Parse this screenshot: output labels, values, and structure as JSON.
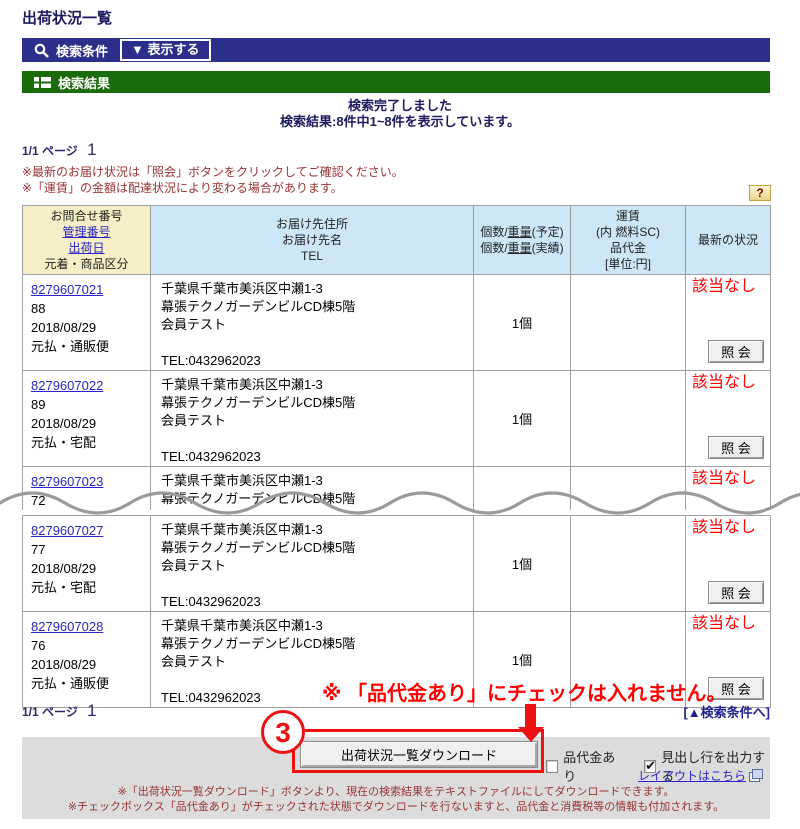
{
  "page_title": "出荷状況一覧",
  "colors": {
    "nav_bar_blue": "#2b2f8a",
    "result_bar_green": "#1a6b0a",
    "table_header_yellow": "#f5eec6",
    "table_header_blue": "#cde7f8",
    "link_blue": "#2a25c8",
    "alert_red": "#ff0000",
    "note_dark_red": "#993333",
    "panel_gray": "#dcdcdc"
  },
  "search_bar": {
    "condition_label": "検索条件",
    "show_button_label": "▼ 表示する"
  },
  "result_bar": {
    "label": "検索結果"
  },
  "status": {
    "line1": "検索完了しました",
    "line2": "検索結果:8件中1~8件を表示しています。"
  },
  "pagination": {
    "label": "1/1 ページ",
    "page_number": "1"
  },
  "notes_top": [
    "※最新のお届け状況は「照会」ボタンをクリックしてご確認ください。",
    "※「運賃」の金額は配達状況により変わる場合があります。"
  ],
  "help_button_label": "?",
  "table": {
    "header": {
      "inquiry_no_label": "お問合せ番号",
      "mgmt_no_link": "管理番号",
      "ship_date_link": "出荷日",
      "category_label": "元着・商品区分",
      "dest_lines": [
        "お届け先住所",
        "お届け先名",
        "TEL"
      ],
      "qty": {
        "l1a": "個数/",
        "l1b": "重量",
        "l1c": "(予定)",
        "l2a": "個数/",
        "l2b": "重量",
        "l2c": "(実績)"
      },
      "fare_lines": [
        "運賃",
        "(内 燃料SC)",
        "品代金",
        "[単位:円]"
      ],
      "status_label": "最新の状況"
    },
    "rows_top": [
      {
        "tracking_no": "8279607021",
        "mgmt_no": "88",
        "ship_date": "2018/08/29",
        "category": "元払・通販便",
        "address1": "千葉県千葉市美浜区中瀬1-3",
        "address2": "幕張テクノガーデンビルCD棟5階",
        "address3": "会員テスト",
        "tel": "TEL:0432962023",
        "qty": "1個",
        "fare": "",
        "status": "該当なし",
        "inquiry_button": "照 会"
      },
      {
        "tracking_no": "8279607022",
        "mgmt_no": "89",
        "ship_date": "2018/08/29",
        "category": "元払・宅配",
        "address1": "千葉県千葉市美浜区中瀬1-3",
        "address2": "幕張テクノガーデンビルCD棟5階",
        "address3": "会員テスト",
        "tel": "TEL:0432962023",
        "qty": "1個",
        "fare": "",
        "status": "該当なし",
        "inquiry_button": "照 会"
      },
      {
        "tracking_no": "8279607023",
        "mgmt_no": "72",
        "address1": "千葉県千葉市美浜区中瀬1-3",
        "address2": "幕張テクノガーデンビルCD棟5階",
        "status": "該当なし"
      }
    ],
    "rows_bottom": [
      {
        "tracking_no": "8279607027",
        "mgmt_no": "77",
        "ship_date": "2018/08/29",
        "category": "元払・宅配",
        "address1": "千葉県千葉市美浜区中瀬1-3",
        "address2": "幕張テクノガーデンビルCD棟5階",
        "address3": "会員テスト",
        "tel": "TEL:0432962023",
        "qty": "1個",
        "fare": "",
        "status": "該当なし",
        "inquiry_button": "照 会"
      },
      {
        "tracking_no": "8279607028",
        "mgmt_no": "76",
        "ship_date": "2018/08/29",
        "category": "元払・通販便",
        "address1": "千葉県千葉市美浜区中瀬1-3",
        "address2": "幕張テクノガーデンビルCD棟5階",
        "address3": "会員テスト",
        "tel": "TEL:0432962023",
        "qty": "1個",
        "fare": "",
        "status": "該当なし",
        "inquiry_button": "照 会"
      }
    ]
  },
  "annotation": {
    "text": "※ 「品代金あり」にチェックは入れません。",
    "step_number": "3"
  },
  "back_to_search_link": "[▲検索条件へ]",
  "download_section": {
    "download_button_label": "出荷状況一覧ダウンロード",
    "monetary_checkbox": {
      "label": "品代金あり",
      "checked": false
    },
    "header_row_checkbox": {
      "label": "見出し行を出力する",
      "checked": true
    },
    "layout_link": "レイアウトはこちら",
    "notes": [
      "※「出荷状況一覧ダウンロード」ボタンより、現在の検索結果をテキストファイルにしてダウンロードできます。",
      "※チェックボックス「品代金あり」がチェックされた状態でダウンロードを行ないますと、品代金と消費税等の情報も付加されます。"
    ]
  }
}
